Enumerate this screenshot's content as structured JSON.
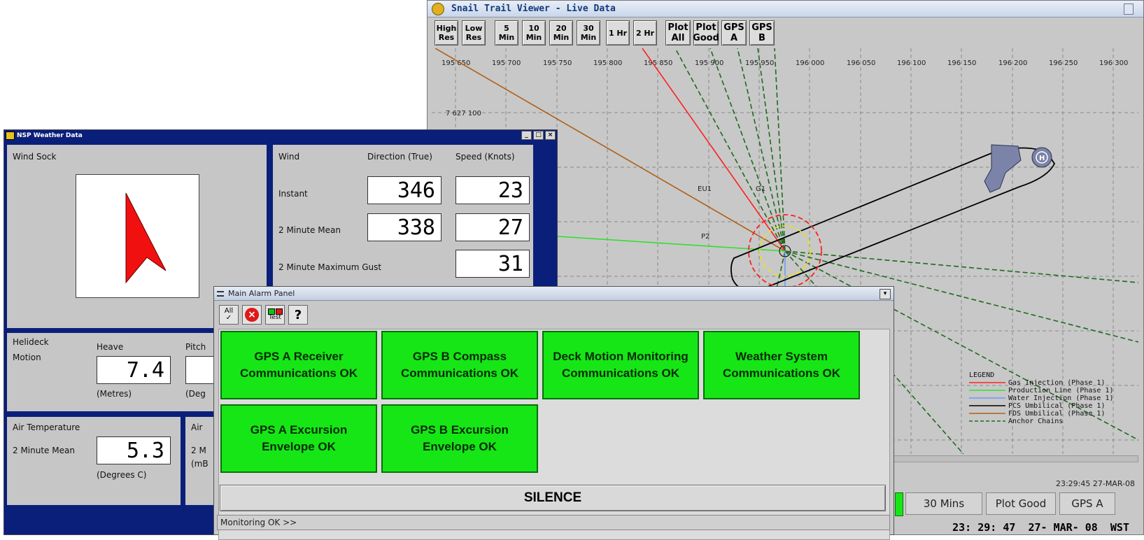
{
  "snail": {
    "title": "Snail Trail Viewer - Live Data",
    "buttons": [
      "High\nRes",
      "Low\nRes",
      "5\nMin",
      "10\nMin",
      "20\nMin",
      "30\nMin",
      "1 Hr",
      "2 Hr",
      "Plot\nAll",
      "Plot\nGood",
      "GPS\nA",
      "GPS\nB"
    ],
    "x_ticks": [
      "195 650",
      "195 700",
      "195 750",
      "195 800",
      "195 850",
      "195 900",
      "195 950",
      "196 000",
      "196 050",
      "196 100",
      "196 150",
      "196 200",
      "196 250",
      "196 300"
    ],
    "y_tick": "7 627 100",
    "map_labels": {
      "eu1": "EU1",
      "g1": "G1",
      "p2": "P2"
    },
    "legend": {
      "title": "LEGEND",
      "items": [
        {
          "label": "Gas Injection (Phase 1)",
          "color": "#ff2020"
        },
        {
          "label": "Production Line (Phase 1)",
          "color": "#30e030"
        },
        {
          "label": "Water Injection (Phase 1)",
          "color": "#6a9cf0"
        },
        {
          "label": "PCS Umbilical (Phase 1)",
          "color": "#000000"
        },
        {
          "label": "FDS Umbilical (Phase 1)",
          "color": "#b06018"
        },
        {
          "label": "Anchor Chains",
          "color": "#1e6a1e",
          "dashed": true
        }
      ]
    },
    "timestamp_small": "23:29:45 27-MAR-08",
    "status_buttons": [
      "30 Mins",
      "Plot Good",
      "GPS A"
    ],
    "clock": "23: 29: 47  27- MAR- 08  WST"
  },
  "weather": {
    "title": "NSP Weather Data",
    "windsock_label": "Wind Sock",
    "wind": {
      "header": "Wind",
      "col_direction": "Direction (True)",
      "col_speed": "Speed (Knots)",
      "rows": [
        {
          "label": "Instant",
          "direction": "346",
          "speed": "23"
        },
        {
          "label": "2 Minute Mean",
          "direction": "338",
          "speed": "27"
        },
        {
          "label": "2 Minute Maximum Gust",
          "direction": "",
          "speed": "31"
        }
      ]
    },
    "helideck": {
      "label1": "Helideck",
      "label2": "Motion",
      "heave_label": "Heave",
      "heave_value": "7.4",
      "heave_unit": "(Metres)",
      "pitch_label": "Pitch",
      "pitch_unit": "(Deg"
    },
    "air": {
      "label": "Air Temperature",
      "mean_label": "2 Minute Mean",
      "value": "5.3",
      "unit": "(Degrees C)",
      "partial_label": "Air",
      "partial_mean": "2 M",
      "partial_unit": "(mB"
    }
  },
  "alarm": {
    "title": "Main Alarm Panel",
    "tools": {
      "all": "All",
      "test": "Test",
      "help": "?"
    },
    "tiles": [
      {
        "line1": "GPS A Receiver",
        "line2": "Communications OK"
      },
      {
        "line1": "GPS B Compass",
        "line2": "Communications OK"
      },
      {
        "line1": "Deck Motion Monitoring",
        "line2": "Communications OK"
      },
      {
        "line1": "Weather System",
        "line2": "Communications OK"
      },
      {
        "line1": "GPS A Excursion",
        "line2": "Envelope OK"
      },
      {
        "line1": "GPS B Excursion",
        "line2": "Envelope OK"
      }
    ],
    "silence": "SILENCE",
    "status": "Monitoring OK >>",
    "tile_color": "#16e616"
  }
}
